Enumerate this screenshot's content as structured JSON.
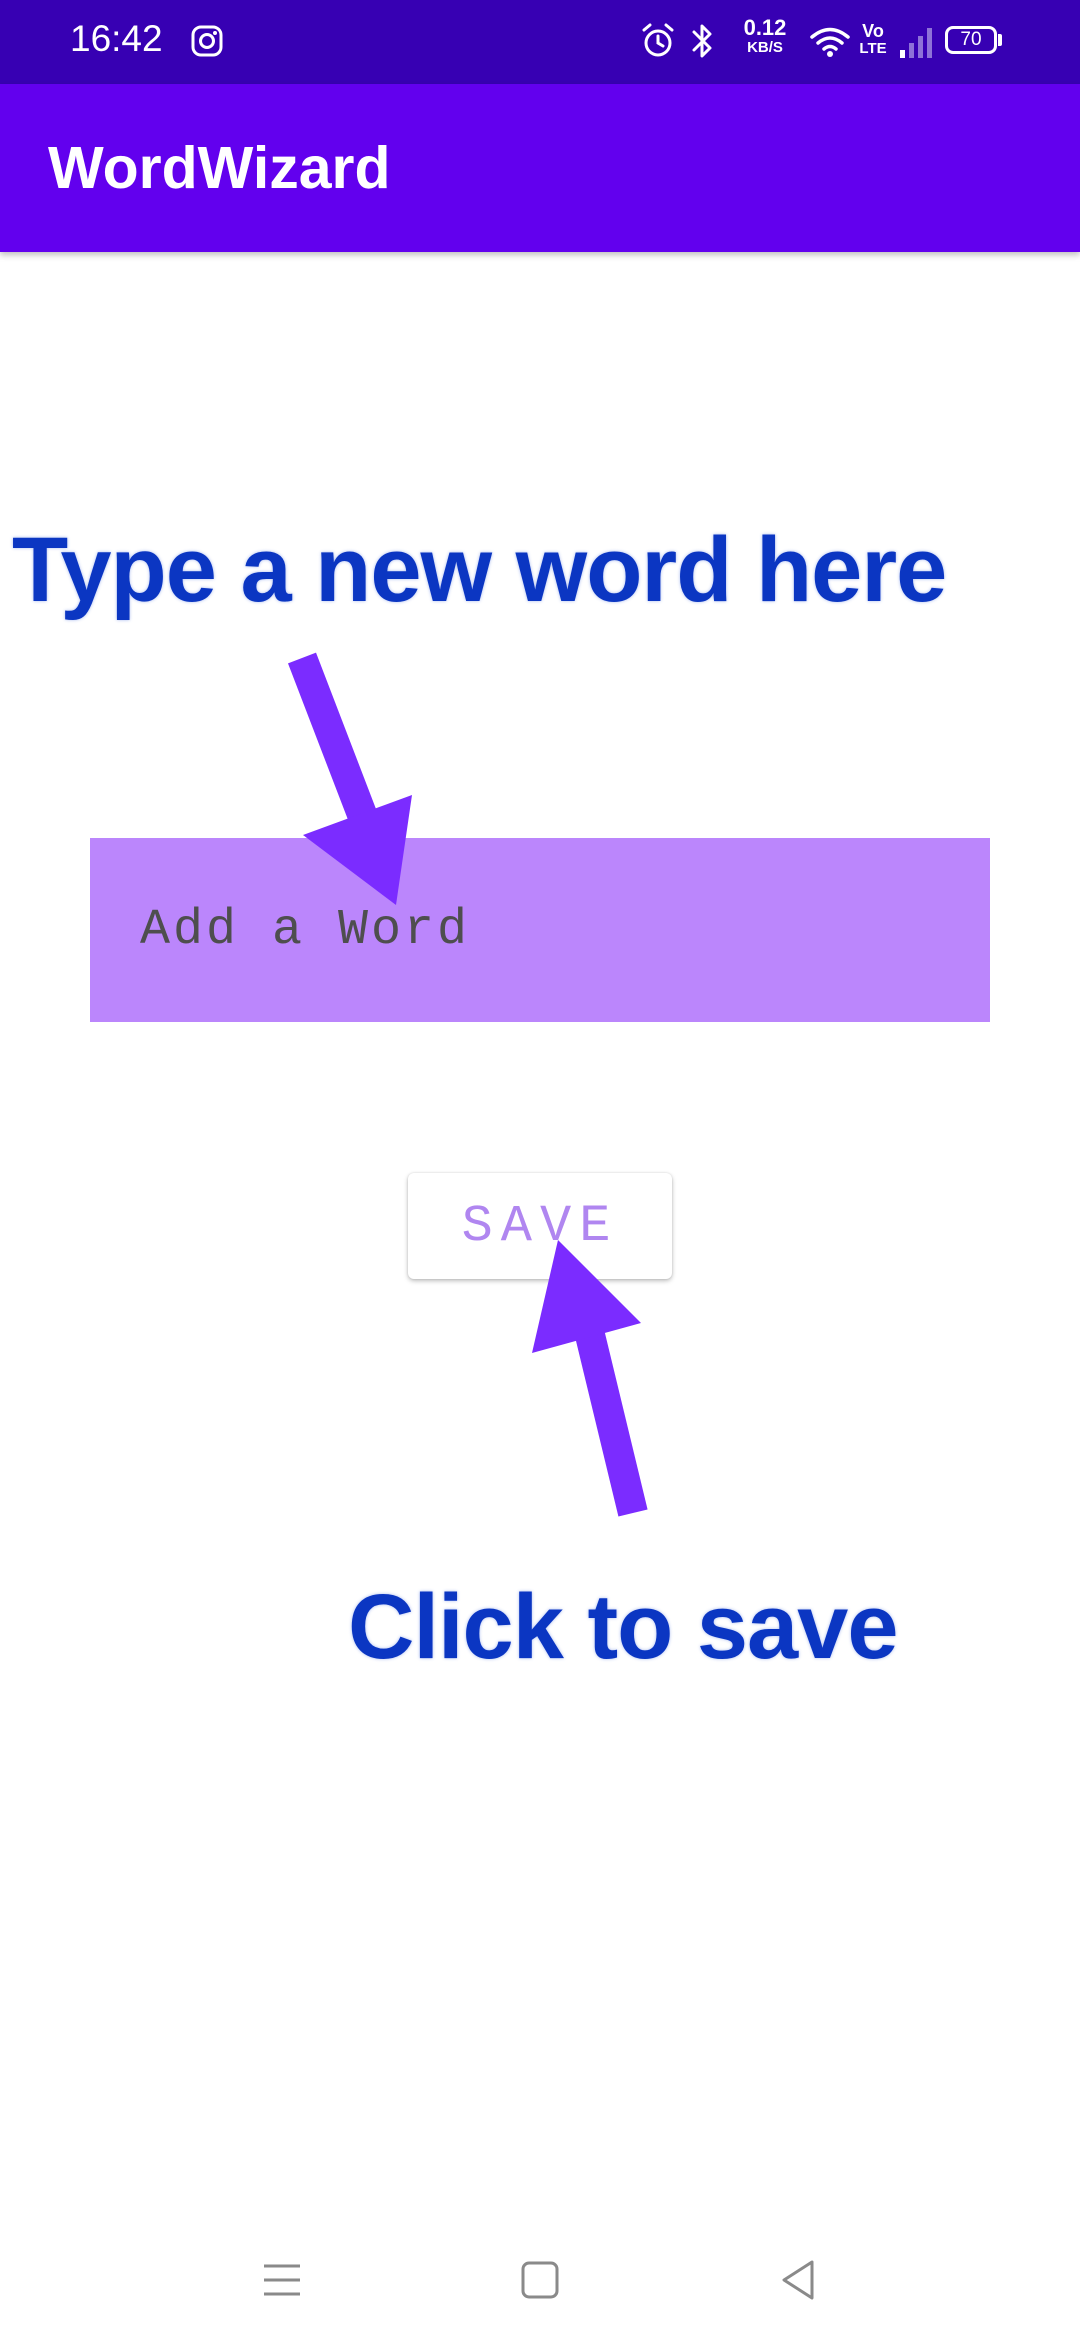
{
  "status_bar": {
    "time": "16:42",
    "net_speed_value": "0.12",
    "net_speed_unit": "KB/S",
    "volte_top": "Vo",
    "volte_bottom": "LTE",
    "battery": "70",
    "icons": [
      "instagram-icon",
      "alarm-icon",
      "bluetooth-icon",
      "wifi-icon",
      "signal-icon",
      "battery-icon"
    ]
  },
  "app_bar": {
    "title": "WordWizard"
  },
  "annotations": {
    "top": "Type a new word here",
    "bottom": "Click to save"
  },
  "form": {
    "input_placeholder": "Add a Word",
    "input_value": "",
    "save_label": "SAVE"
  },
  "nav_bar": {
    "items": [
      "menu-icon",
      "home-square-icon",
      "back-triangle-icon"
    ]
  },
  "colors": {
    "status_bar": "#3700b3",
    "app_bar": "#6200ee",
    "input_background": "#bb86fc",
    "annotation_text": "#0b36c2",
    "arrow": "#7b2cff",
    "save_text": "#b086f0"
  }
}
